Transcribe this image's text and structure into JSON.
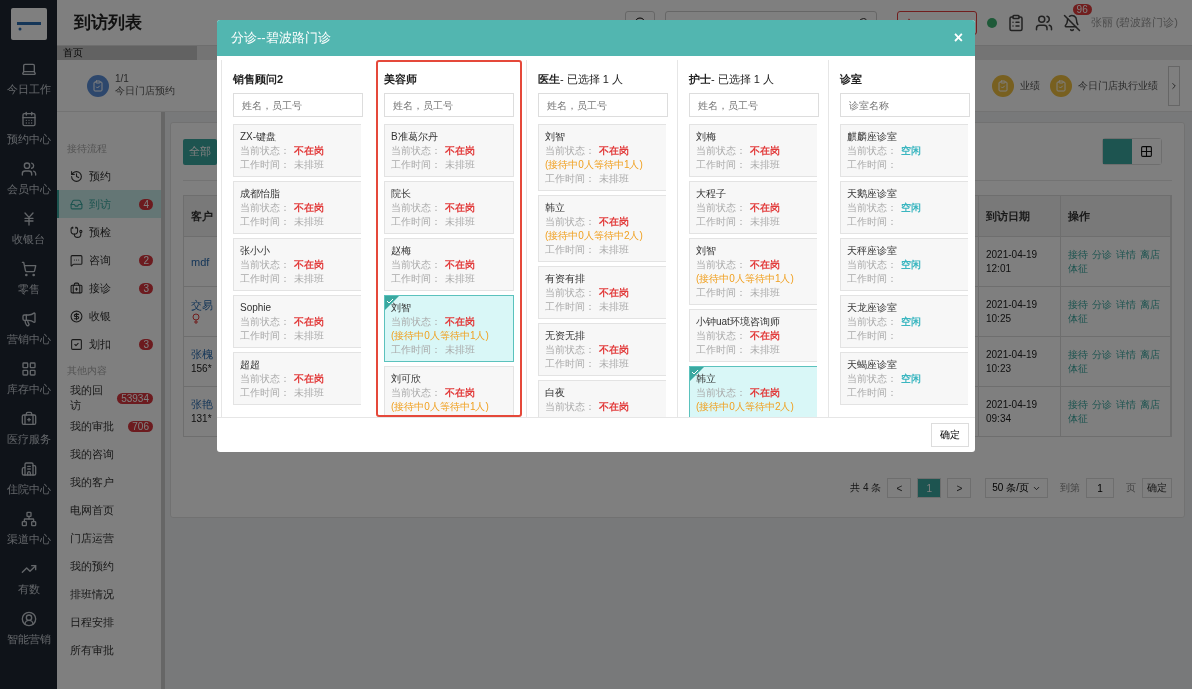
{
  "nav_rail": {
    "items": [
      {
        "label": "今日工作"
      },
      {
        "label": "预约中心"
      },
      {
        "label": "会员中心"
      },
      {
        "label": "收银台"
      },
      {
        "label": "零售"
      },
      {
        "label": "营销中心"
      },
      {
        "label": "库存中心"
      },
      {
        "label": "医疗服务"
      },
      {
        "label": "住院中心"
      },
      {
        "label": "渠道中心"
      },
      {
        "label": "有数"
      },
      {
        "label": "智能营销"
      }
    ]
  },
  "header": {
    "title": "到访列表",
    "notification_count": "96",
    "user": "张丽 (碧波路门诊)"
  },
  "tabs": [
    {
      "label": "首页",
      "selected": true
    }
  ],
  "stats": [
    {
      "value": "1/1",
      "label": "今日门店预约"
    },
    {
      "label": "业绩"
    },
    {
      "label": "今日门店执行业绩"
    }
  ],
  "sub_sidebar": {
    "sections": [
      {
        "title": "接待流程",
        "items": [
          {
            "label": "预约",
            "selected": false
          },
          {
            "label": "到访",
            "selected": true,
            "badge": "4"
          },
          {
            "label": "预检",
            "selected": false
          },
          {
            "label": "咨询",
            "selected": false,
            "badge": "2"
          },
          {
            "label": "接诊",
            "selected": false,
            "badge": "3"
          },
          {
            "label": "收银",
            "selected": false
          },
          {
            "label": "划扣",
            "selected": false,
            "badge": "3"
          }
        ]
      },
      {
        "title": "其他内容",
        "items": [
          {
            "label": "我的回访",
            "selected": false,
            "badge": "53934"
          },
          {
            "label": "我的审批",
            "selected": false,
            "badge": "706"
          },
          {
            "label": "我的咨询",
            "selected": false
          },
          {
            "label": "我的客户",
            "selected": false
          },
          {
            "label": "电网首页",
            "selected": false
          },
          {
            "label": "门店运营",
            "selected": false
          },
          {
            "label": "我的预约",
            "selected": false
          },
          {
            "label": "排班情况",
            "selected": false
          },
          {
            "label": "日程安排",
            "selected": false
          },
          {
            "label": "所有审批",
            "selected": false
          }
        ]
      }
    ]
  },
  "content": {
    "filter_button": "全部",
    "view_toggle": [
      {
        "kind": "list",
        "selected": true
      },
      {
        "kind": "grid",
        "selected": false
      }
    ],
    "table": {
      "columns": [
        "客户",
        "到访日期",
        "操作"
      ],
      "rows": [
        {
          "customer": "mdf",
          "phone": null,
          "female": false,
          "date": "2021-04-19",
          "time": "12:01",
          "actions": [
            "接待",
            "分诊",
            "详情",
            "离店",
            "体征"
          ]
        },
        {
          "customer": "交易",
          "phone": null,
          "female": true,
          "date": "2021-04-19",
          "time": "10:25",
          "actions": [
            "接待",
            "分诊",
            "详情",
            "离店",
            "体征"
          ]
        },
        {
          "customer": "张槐",
          "phone": "156*",
          "female": false,
          "date": "2021-04-19",
          "time": "10:23",
          "actions": [
            "接待",
            "分诊",
            "详情",
            "离店",
            "体征"
          ]
        },
        {
          "customer": "张艳",
          "phone": "131*",
          "female": false,
          "date": "2021-04-19",
          "time": "09:34",
          "actions": [
            "接待",
            "分诊",
            "详情",
            "离店",
            "体征"
          ]
        }
      ]
    },
    "pagination": {
      "total": "共 4 条",
      "prev": "<",
      "pages": [
        {
          "label": "1",
          "selected": true
        }
      ],
      "next": ">",
      "page_size": "50 条/页",
      "goto_label": "到第",
      "goto_value": "1",
      "page_label": "页",
      "confirm": "确定"
    }
  },
  "modal": {
    "title": "分诊--碧波路门诊",
    "close": "×",
    "confirm": "确定",
    "columns": [
      {
        "title": "销售顾问2",
        "highlighted": false,
        "search": {
          "placeholder": "姓名，员工号"
        },
        "cards": [
          {
            "name": "ZX-键盘",
            "selected": false,
            "status_label": "当前状态：",
            "status": "不在岗",
            "color": "#e23c3c",
            "time_label": "工作时间：",
            "time": "未排班"
          },
          {
            "name": "成都怡脂",
            "selected": false,
            "status_label": "当前状态：",
            "status": "不在岗",
            "color": "#e23c3c",
            "time_label": "工作时间：",
            "time": "未排班"
          },
          {
            "name": "张小小",
            "selected": false,
            "status_label": "当前状态：",
            "status": "不在岗",
            "color": "#e23c3c",
            "time_label": "工作时间：",
            "time": "未排班"
          },
          {
            "name": "Sophie",
            "selected": false,
            "status_label": "当前状态：",
            "status": "不在岗",
            "color": "#e23c3c",
            "time_label": "工作时间：",
            "time": "未排班"
          },
          {
            "name": "超超",
            "selected": false,
            "status_label": "当前状态：",
            "status": "不在岗",
            "color": "#e23c3c",
            "time_label": "工作时间：",
            "time": "未排班"
          }
        ]
      },
      {
        "title": "美容师",
        "highlighted": true,
        "search": {
          "placeholder": "姓名，员工号"
        },
        "cards": [
          {
            "name": "B准葛尔丹",
            "selected": false,
            "status_label": "当前状态：",
            "status": "不在岗",
            "color": "#e23c3c",
            "time_label": "工作时间：",
            "time": "未排班"
          },
          {
            "name": "院长",
            "selected": false,
            "status_label": "当前状态：",
            "status": "不在岗",
            "color": "#e23c3c",
            "time_label": "工作时间：",
            "time": "未排班"
          },
          {
            "name": "赵梅",
            "selected": false,
            "status_label": "当前状态：",
            "status": "不在岗",
            "color": "#e23c3c",
            "time_label": "工作时间：",
            "time": "未排班"
          },
          {
            "name": "刘智",
            "selected": true,
            "status_label": "当前状态：",
            "status": "不在岗",
            "color": "#e23c3c",
            "queue": "(接待中0人等待中1人)",
            "time_label": "工作时间：",
            "time": "未排班"
          },
          {
            "name": "刘可欣",
            "selected": false,
            "status_label": "当前状态：",
            "status": "不在岗",
            "color": "#e23c3c",
            "queue": "(接待中0人等待中1人)"
          }
        ]
      },
      {
        "title": "医生",
        "note": "- 已选择 1 人",
        "highlighted": false,
        "search": {
          "placeholder": "姓名，员工号"
        },
        "cards": [
          {
            "name": "刘智",
            "selected": false,
            "status_label": "当前状态：",
            "status": "不在岗",
            "color": "#e23c3c",
            "queue": "(接待中0人等待中1人)",
            "time_label": "工作时间：",
            "time": "未排班"
          },
          {
            "name": "韩立",
            "selected": false,
            "status_label": "当前状态：",
            "status": "不在岗",
            "color": "#e23c3c",
            "queue": "(接待中0人等待中2人)",
            "time_label": "工作时间：",
            "time": "未排班"
          },
          {
            "name": "有资有排",
            "selected": false,
            "status_label": "当前状态：",
            "status": "不在岗",
            "color": "#e23c3c",
            "time_label": "工作时间：",
            "time": "未排班"
          },
          {
            "name": "无资无排",
            "selected": false,
            "status_label": "当前状态：",
            "status": "不在岗",
            "color": "#e23c3c",
            "time_label": "工作时间：",
            "time": "未排班"
          },
          {
            "name": "白夜",
            "selected": false,
            "status_label": "当前状态：",
            "status": "不在岗",
            "color": "#e23c3c"
          }
        ]
      },
      {
        "title": "护士",
        "note": "- 已选择 1 人",
        "highlighted": false,
        "search": {
          "placeholder": "姓名，员工号"
        },
        "cards": [
          {
            "name": "刘梅",
            "selected": false,
            "status_label": "当前状态：",
            "status": "不在岗",
            "color": "#e23c3c",
            "time_label": "工作时间：",
            "time": "未排班"
          },
          {
            "name": "大程子",
            "selected": false,
            "status_label": "当前状态：",
            "status": "不在岗",
            "color": "#e23c3c",
            "time_label": "工作时间：",
            "time": "未排班"
          },
          {
            "name": "刘智",
            "selected": false,
            "status_label": "当前状态：",
            "status": "不在岗",
            "color": "#e23c3c",
            "queue": "(接待中0人等待中1人)",
            "time_label": "工作时间：",
            "time": "未排班"
          },
          {
            "name": "小钟uat环境咨询师",
            "selected": false,
            "status_label": "当前状态：",
            "status": "不在岗",
            "color": "#e23c3c",
            "time_label": "工作时间：",
            "time": "未排班"
          },
          {
            "name": "韩立",
            "selected": true,
            "status_label": "当前状态：",
            "status": "不在岗",
            "color": "#e23c3c",
            "queue": "(接待中0人等待中2人)"
          }
        ]
      },
      {
        "title": "诊室",
        "highlighted": false,
        "search": {
          "placeholder": "诊室名称"
        },
        "cards": [
          {
            "name": "麒麟座诊室",
            "selected": false,
            "status_label": "当前状态：",
            "status": "空闲",
            "color": "#3bb6c0",
            "time_label": "工作时间："
          },
          {
            "name": "天鹅座诊室",
            "selected": false,
            "status_label": "当前状态：",
            "status": "空闲",
            "color": "#3bb6c0",
            "time_label": "工作时间："
          },
          {
            "name": "天秤座诊室",
            "selected": false,
            "status_label": "当前状态：",
            "status": "空闲",
            "color": "#3bb6c0",
            "time_label": "工作时间："
          },
          {
            "name": "天龙座诊室",
            "selected": false,
            "status_label": "当前状态：",
            "status": "空闲",
            "color": "#3bb6c0",
            "time_label": "工作时间："
          },
          {
            "name": "天蝎座诊室",
            "selected": false,
            "status_label": "当前状态：",
            "status": "空闲",
            "color": "#3bb6c0",
            "time_label": "工作时间："
          }
        ]
      }
    ]
  }
}
